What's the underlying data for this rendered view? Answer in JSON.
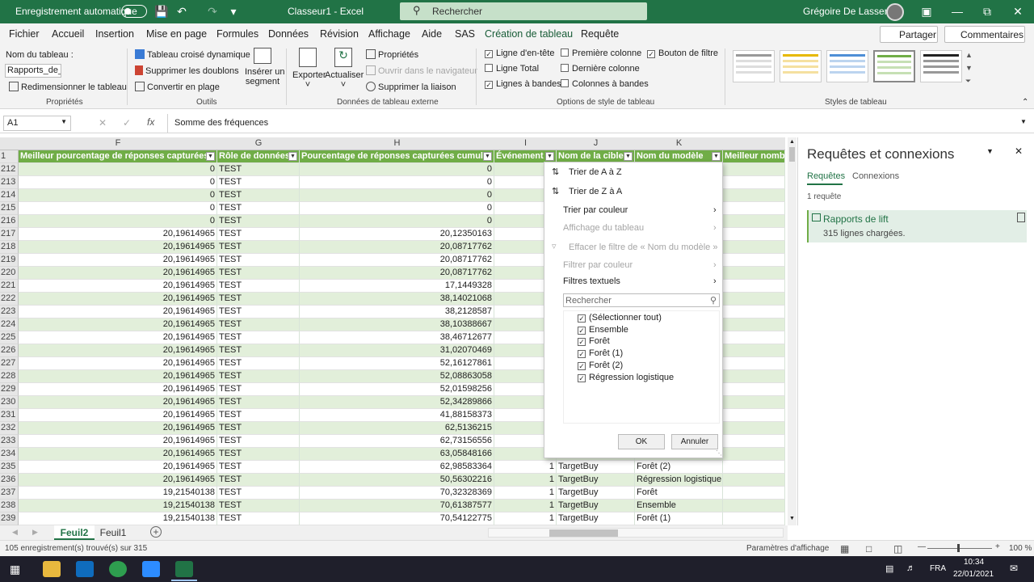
{
  "titlebar": {
    "autosave": "Enregistrement automatique",
    "filename": "Classeur1  -  Excel",
    "search": "Rechercher",
    "user": "Grégoire De Lassence"
  },
  "tabs": [
    "Fichier",
    "Accueil",
    "Insertion",
    "Mise en page",
    "Formules",
    "Données",
    "Révision",
    "Affichage",
    "Aide",
    "SAS",
    "Création de tableau",
    "Requête"
  ],
  "share": "Partager",
  "comments": "Commentaires",
  "ribbon": {
    "table_name_label": "Nom du tableau :",
    "table_name_value": "Rapports_de_li",
    "resize": "Redimensionner le tableau",
    "grp_props": "Propriétés",
    "pivot": "Tableau croisé dynamique",
    "remove_dup": "Supprimer les doublons",
    "convert": "Convertir en plage",
    "slicer1": "Insérer un",
    "slicer2": "segment",
    "grp_tools": "Outils",
    "export": "Exporter",
    "refresh": "Actualiser",
    "properties": "Propriétés",
    "open_browser": "Ouvrir dans le navigateur",
    "unlink": "Supprimer la liaison",
    "grp_ext": "Données de tableau externe",
    "opt_header": "Ligne d'en-tête",
    "opt_first": "Première colonne",
    "opt_filter": "Bouton de filtre",
    "opt_total": "Ligne Total",
    "opt_last": "Dernière colonne",
    "opt_banded_rows": "Lignes à bandes",
    "opt_banded_cols": "Colonnes à bandes",
    "grp_opts": "Options de style de tableau",
    "grp_styles": "Styles de tableau"
  },
  "formula": {
    "namebox": "A1",
    "content": "Somme des fréquences",
    "fx": "fx"
  },
  "columns": [
    "F",
    "G",
    "H",
    "I",
    "J",
    "K"
  ],
  "headers": [
    "Meilleur pourcentage de réponses capturées",
    "Rôle de données",
    "Pourcentage de réponses capturées cumulé",
    "Événement",
    "Nom de la cible",
    "Nom du modèle",
    "Meilleur nomb"
  ],
  "rows": [
    {
      "n": "212",
      "f": "0",
      "g": "TEST",
      "h": "0",
      "i": "",
      "j": "",
      "k": ""
    },
    {
      "n": "213",
      "f": "0",
      "g": "TEST",
      "h": "0",
      "i": "",
      "j": "",
      "k": ""
    },
    {
      "n": "214",
      "f": "0",
      "g": "TEST",
      "h": "0",
      "i": "",
      "j": "",
      "k": ""
    },
    {
      "n": "215",
      "f": "0",
      "g": "TEST",
      "h": "0",
      "i": "",
      "j": "",
      "k": ""
    },
    {
      "n": "216",
      "f": "0",
      "g": "TEST",
      "h": "0",
      "i": "",
      "j": "",
      "k": ""
    },
    {
      "n": "217",
      "f": "20,19614965",
      "g": "TEST",
      "h": "20,12350163",
      "i": "",
      "j": "",
      "k": ""
    },
    {
      "n": "218",
      "f": "20,19614965",
      "g": "TEST",
      "h": "20,08717762",
      "i": "",
      "j": "",
      "k": ""
    },
    {
      "n": "219",
      "f": "20,19614965",
      "g": "TEST",
      "h": "20,08717762",
      "i": "",
      "j": "",
      "k": ""
    },
    {
      "n": "220",
      "f": "20,19614965",
      "g": "TEST",
      "h": "20,08717762",
      "i": "",
      "j": "",
      "k": ""
    },
    {
      "n": "221",
      "f": "20,19614965",
      "g": "TEST",
      "h": "17,1449328",
      "i": "",
      "j": "",
      "k": ""
    },
    {
      "n": "222",
      "f": "20,19614965",
      "g": "TEST",
      "h": "38,14021068",
      "i": "",
      "j": "",
      "k": ""
    },
    {
      "n": "223",
      "f": "20,19614965",
      "g": "TEST",
      "h": "38,2128587",
      "i": "",
      "j": "",
      "k": ""
    },
    {
      "n": "224",
      "f": "20,19614965",
      "g": "TEST",
      "h": "38,10388667",
      "i": "",
      "j": "",
      "k": ""
    },
    {
      "n": "225",
      "f": "20,19614965",
      "g": "TEST",
      "h": "38,46712677",
      "i": "",
      "j": "",
      "k": ""
    },
    {
      "n": "226",
      "f": "20,19614965",
      "g": "TEST",
      "h": "31,02070469",
      "i": "",
      "j": "",
      "k": ""
    },
    {
      "n": "227",
      "f": "20,19614965",
      "g": "TEST",
      "h": "52,16127861",
      "i": "",
      "j": "",
      "k": ""
    },
    {
      "n": "228",
      "f": "20,19614965",
      "g": "TEST",
      "h": "52,08863058",
      "i": "",
      "j": "",
      "k": ""
    },
    {
      "n": "229",
      "f": "20,19614965",
      "g": "TEST",
      "h": "52,01598256",
      "i": "",
      "j": "",
      "k": ""
    },
    {
      "n": "230",
      "f": "20,19614965",
      "g": "TEST",
      "h": "52,34289866",
      "i": "",
      "j": "",
      "k": ""
    },
    {
      "n": "231",
      "f": "20,19614965",
      "g": "TEST",
      "h": "41,88158373",
      "i": "",
      "j": "",
      "k": ""
    },
    {
      "n": "232",
      "f": "20,19614965",
      "g": "TEST",
      "h": "62,5136215",
      "i": "",
      "j": "",
      "k": ""
    },
    {
      "n": "233",
      "f": "20,19614965",
      "g": "TEST",
      "h": "62,73156556",
      "i": "",
      "j": "",
      "k": ""
    },
    {
      "n": "234",
      "f": "20,19614965",
      "g": "TEST",
      "h": "63,05848166",
      "i": "",
      "j": "",
      "k": ""
    },
    {
      "n": "235",
      "f": "20,19614965",
      "g": "TEST",
      "h": "62,98583364",
      "i": "1",
      "j": "TargetBuy",
      "k": "Forêt (2)"
    },
    {
      "n": "236",
      "f": "20,19614965",
      "g": "TEST",
      "h": "50,56302216",
      "i": "1",
      "j": "TargetBuy",
      "k": "Régression logistique"
    },
    {
      "n": "237",
      "f": "19,21540138",
      "g": "TEST",
      "h": "70,32328369",
      "i": "1",
      "j": "TargetBuy",
      "k": "Forêt"
    },
    {
      "n": "238",
      "f": "19,21540138",
      "g": "TEST",
      "h": "70,61387577",
      "i": "1",
      "j": "TargetBuy",
      "k": "Ensemble"
    },
    {
      "n": "239",
      "f": "19,21540138",
      "g": "TEST",
      "h": "70,54122775",
      "i": "1",
      "j": "TargetBuy",
      "k": "Forêt (1)"
    }
  ],
  "filter": {
    "sort_az": "Trier de A à Z",
    "sort_za": "Trier de Z à A",
    "sort_color": "Trier par couleur",
    "sheet_view": "Affichage du tableau",
    "clear": "Effacer le filtre de « Nom du modèle »",
    "filter_color": "Filtrer par couleur",
    "text_filters": "Filtres textuels",
    "search": "Rechercher",
    "items": [
      "(Sélectionner tout)",
      "Ensemble",
      "Forêt",
      "Forêt (1)",
      "Forêt (2)",
      "Régression logistique"
    ],
    "ok": "OK",
    "cancel": "Annuler"
  },
  "panel": {
    "title": "Requêtes et connexions",
    "tab1": "Requêtes",
    "tab2": "Connexions",
    "count": "1 requête",
    "query": "Rapports de lift",
    "loaded": "315 lignes chargées."
  },
  "sheets": [
    "Feuil2",
    "Feuil1"
  ],
  "status": {
    "left": "105 enregistrement(s) trouvé(s) sur 315",
    "display": "Paramètres d'affichage",
    "zoom": "100 %"
  },
  "taskbar": {
    "lang": "FRA",
    "time": "10:34",
    "date": "22/01/2021"
  }
}
